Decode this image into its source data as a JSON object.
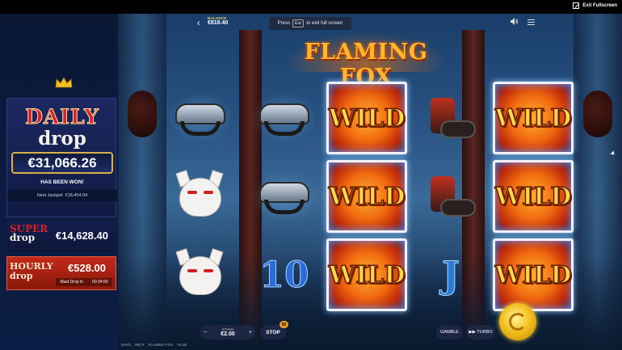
{
  "fullscreen": {
    "exit_label": "Exit Fullscreen"
  },
  "hud": {
    "balance_label": "BALANCE",
    "balance_value": "€818.40",
    "esc_prefix": "Press",
    "esc_key": "Esc",
    "esc_suffix": "to exit full screen"
  },
  "logo": {
    "title": "FLAMING FOX"
  },
  "jackpots": {
    "daily_title": "DAILY",
    "daily_sub": "drop",
    "daily_amount": "€31,066.26",
    "has_been_won": "HAS BEEN WON!",
    "next_jackpot_label": "Next Jackpot",
    "next_jackpot_value": "€18,454.94",
    "super_title": "SUPER",
    "super_sub": "drop",
    "super_amount": "€14,628.40",
    "hourly_title": "HOURLY",
    "hourly_sub": "drop",
    "hourly_amount": "€528.00",
    "must_drop_label": "Must Drop In",
    "must_drop_timer": "00:34:50"
  },
  "reels": {
    "wild_label": "WILD",
    "ten_label": "10",
    "jay_label": "J"
  },
  "controls": {
    "stake_label": "STAKE",
    "stake_value": "€2.00",
    "minus": "−",
    "plus": "+",
    "stop_label": "STOP",
    "autoplay_count": "50",
    "gamble_label": "GAMBLE",
    "turbo_label": "▶▶ TURBO"
  },
  "footer": {
    "items": [
      "DAYS",
      "HELP",
      "FLAMING FOX",
      "V5.35"
    ]
  }
}
